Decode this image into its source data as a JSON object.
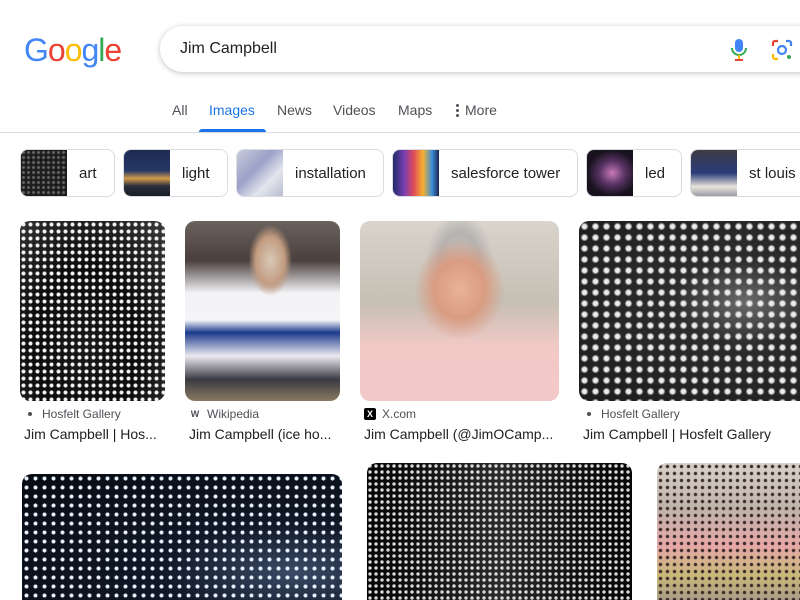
{
  "search": {
    "query": "Jim Campbell"
  },
  "logo": {
    "letters": [
      "G",
      "o",
      "o",
      "g",
      "l",
      "e"
    ],
    "colors": [
      "#4285F4",
      "#EA4335",
      "#FBBC05",
      "#4285F4",
      "#34A853",
      "#EA4335"
    ]
  },
  "tabs": [
    {
      "label": "All"
    },
    {
      "label": "Images",
      "active": true
    },
    {
      "label": "News"
    },
    {
      "label": "Videos"
    },
    {
      "label": "Maps"
    },
    {
      "label": "More"
    }
  ],
  "chips": [
    {
      "label": "art"
    },
    {
      "label": "light"
    },
    {
      "label": "installation"
    },
    {
      "label": "salesforce tower"
    },
    {
      "label": "led"
    },
    {
      "label": "st louis"
    }
  ],
  "results": [
    {
      "source": "Hosfelt Gallery",
      "title": "Jim Campbell | Hos..."
    },
    {
      "source": "Wikipedia",
      "title": "Jim Campbell (ice ho..."
    },
    {
      "source": "X.com",
      "title": "Jim Campbell (@JimOCamp..."
    },
    {
      "source": "Hosfelt Gallery",
      "title": "Jim Campbell | Hosfelt Gallery"
    }
  ],
  "colors": {
    "accent": "#1a73e8",
    "text": "#202124",
    "muted": "#4d5156"
  }
}
